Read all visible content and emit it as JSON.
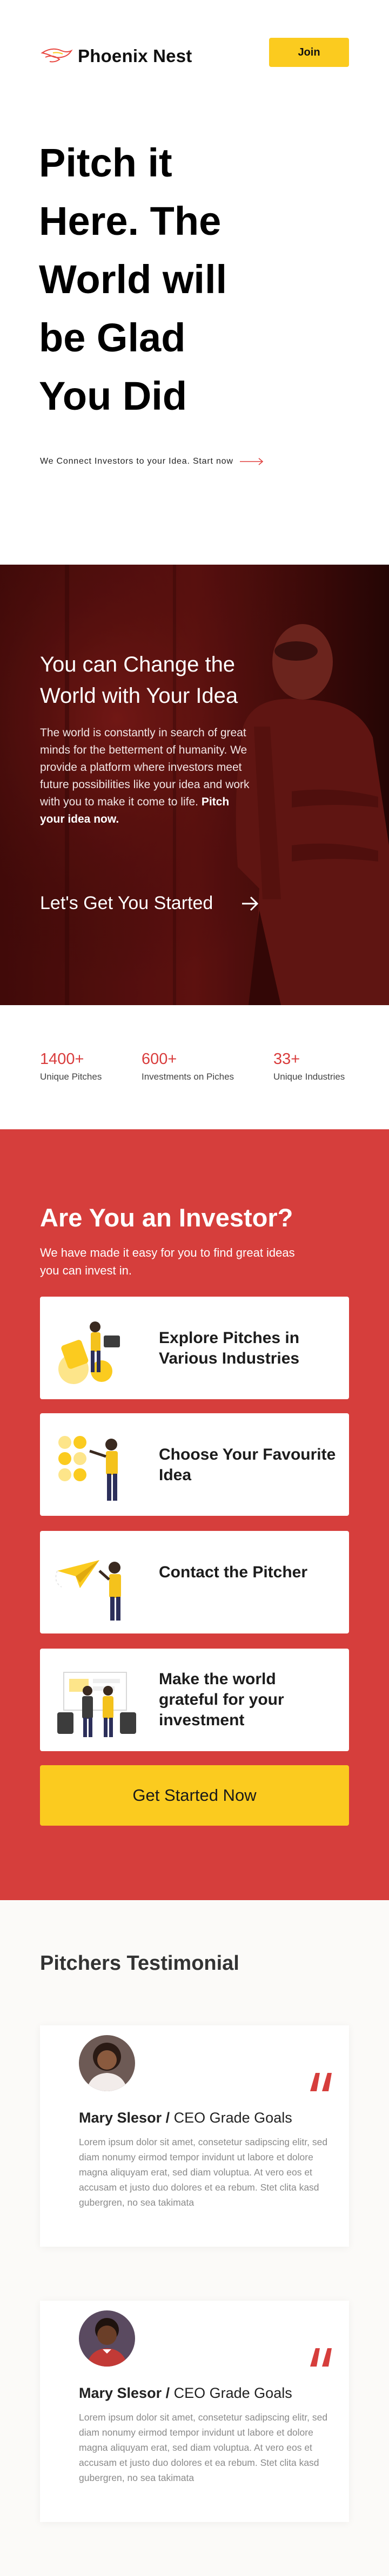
{
  "header": {
    "brand": "Phoenix Nest",
    "join_label": "Join"
  },
  "hero": {
    "title_lines": [
      "Pitch it",
      "Here. The",
      "World will",
      "be Glad",
      "You Did"
    ],
    "link_text": "We Connect Investors to your Idea. Start now"
  },
  "promo": {
    "title": "You can Change the World with Your Idea",
    "text": "The world is constantly in search of great minds for the betterment of humanity. We provide a platform where investors meet future possibilities like your idea and work with you to make it come to life.",
    "text_bold": "Pitch your idea now.",
    "cta": "Let's Get You Started"
  },
  "stats": [
    {
      "value": "1400+",
      "label": "Unique Pitches"
    },
    {
      "value": "600+",
      "label": "Investments on Piches"
    },
    {
      "value": "33+",
      "label": "Unique Industries"
    }
  ],
  "investor": {
    "title_prefix": "Are You an",
    "title_bold": "Investor?",
    "subtitle": "We have made it easy for you to find great ideas you can invest in.",
    "cards": [
      {
        "text": "Explore Pitches in Various Industries"
      },
      {
        "text": "Choose Your Favourite Idea"
      },
      {
        "text": "Contact the Pitcher"
      },
      {
        "text": "Make the world grateful for your investment"
      }
    ],
    "cta": "Get Started Now"
  },
  "testimonials": {
    "title_bold": "Pitchers",
    "title_rest": "Testimonial",
    "items": [
      {
        "name": "Mary Slesor",
        "role": "CEO Grade Goals",
        "body": "Lorem ipsum dolor sit amet, consetetur sadipscing elitr, sed diam nonumy eirmod tempor invidunt ut labore et dolore magna aliquyam erat, sed diam voluptua. At vero eos et accusam et justo duo dolores et ea rebum. Stet clita kasd gubergren, no sea takimata"
      },
      {
        "name": "Mary Slesor",
        "role": "CEO Grade Goals",
        "body": "Lorem ipsum dolor sit amet, consetetur sadipscing elitr, sed diam nonumy eirmod tempor invidunt ut labore et dolore magna aliquyam erat, sed diam voluptua. At vero eos et accusam et justo duo dolores et ea rebum. Stet clita kasd gubergren, no sea takimata"
      }
    ]
  },
  "colors": {
    "accent_yellow": "#fbcb1f",
    "accent_red": "#d63e3c",
    "dark_red": "#5b0f0e"
  }
}
